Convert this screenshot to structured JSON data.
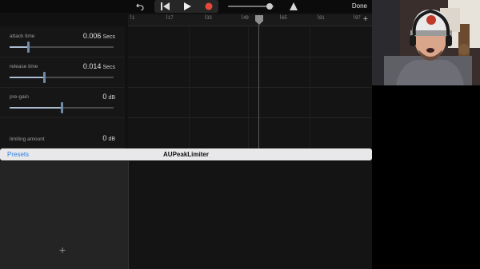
{
  "toolbar": {
    "undo_icon": "undo-icon",
    "rewind_icon": "rewind-icon",
    "play_icon": "play-icon",
    "record_icon": "record-icon",
    "metronome_icon": "metronome-icon",
    "done_label": "Done",
    "master_volume": 0.9,
    "colors": {
      "record": "#e5483a",
      "toolbar_bg": "#0b0b0b"
    }
  },
  "ruler": {
    "marks": [
      "1",
      "17",
      "33",
      "49",
      "65",
      "81",
      "97"
    ],
    "add_label": "+"
  },
  "plugin": {
    "name": "AUPeakLimiter",
    "presets_label": "Presets",
    "params": [
      {
        "name": "attack time",
        "value": "0.006",
        "unit": "Secs",
        "level": 0.18
      },
      {
        "name": "release time",
        "value": "0.014",
        "unit": "Secs",
        "level": 0.33
      },
      {
        "name": "pre-gain",
        "value": "0",
        "unit": "dB",
        "level": 0.5
      },
      {
        "name": "limiting amount",
        "value": "0",
        "unit": "dB"
      }
    ]
  },
  "track_list": {
    "add_label": "+"
  },
  "colors": {
    "accent": "#2f7fe0",
    "slider": "#a9bcd0"
  }
}
